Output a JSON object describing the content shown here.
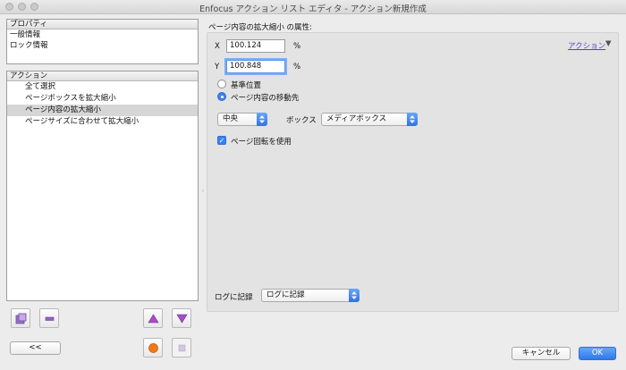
{
  "window": {
    "title": "Enfocus アクション リスト エディタ - アクション新規作成"
  },
  "properties": {
    "header": "プロパティ",
    "items": [
      "一般情報",
      "ロック情報"
    ]
  },
  "actions": {
    "header": "アクション",
    "items": [
      {
        "label": "全て選択",
        "selected": false
      },
      {
        "label": "ページボックスを拡大縮小",
        "selected": false
      },
      {
        "label": "ページ内容の拡大縮小",
        "selected": true
      },
      {
        "label": "ページサイズに合わせて拡大縮小",
        "selected": false
      }
    ]
  },
  "left_buttons": {
    "back_label": "<<"
  },
  "detail": {
    "heading": "ページ内容の拡大縮小 の属性:",
    "actions_link": "アクション",
    "x_label": "X",
    "x_value": "100.124",
    "x_unit": "%",
    "y_label": "Y",
    "y_value": "100.848",
    "y_unit": "%",
    "radio_base": "基準位置",
    "radio_move": "ページ内容の移動先",
    "align_value": "中央",
    "box_label": "ボックス",
    "box_value": "メディアボックス",
    "rotate_label": "ページ回転を使用",
    "log_label": "ログに記録",
    "log_value": "ログに記録"
  },
  "footer": {
    "cancel_label": "キャンセル",
    "ok_label": "OK"
  },
  "colors": {
    "accent": "#3a82f0",
    "link": "#5a43c9",
    "selection": "#d6d6d6"
  }
}
